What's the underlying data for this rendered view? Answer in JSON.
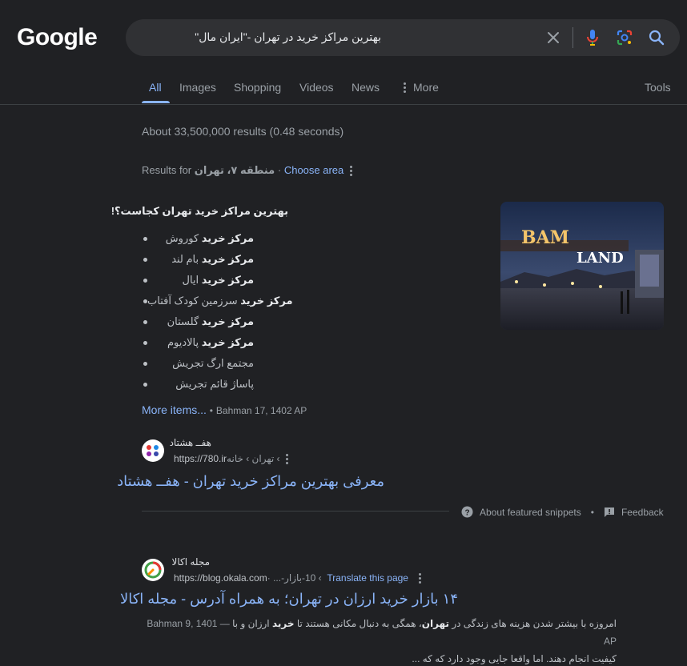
{
  "logo": "Google",
  "search": {
    "query": "بهترین مراکز خرید در تهران -\"ایران مال\""
  },
  "tabs": [
    {
      "label": "All"
    },
    {
      "label": "Images"
    },
    {
      "label": "Shopping"
    },
    {
      "label": "Videos"
    },
    {
      "label": "News"
    },
    {
      "label": "More"
    }
  ],
  "tools_label": "Tools",
  "stats": "About 33,500,000 results (0.48 seconds)",
  "results_for": {
    "prefix": "Results for",
    "area": "منطقه ۷، تهران",
    "sep": "·",
    "choose": "Choose area"
  },
  "featured": {
    "title": "بهترین مراکز خرید تهران کجاست؟!",
    "items": [
      {
        "bold": "مرکز خرید",
        "rest": " کوروش"
      },
      {
        "bold": "مرکز خرید",
        "rest": " بام لند"
      },
      {
        "bold": "مرکز خرید",
        "rest": " ایال"
      },
      {
        "bold": "مرکز خرید",
        "rest": " سرزمین کودک آفتاب"
      },
      {
        "bold": "مرکز خرید",
        "rest": " گلستان"
      },
      {
        "bold": "مرکز خرید",
        "rest": " پالادیوم"
      },
      {
        "bold": "",
        "rest": "مجتمع ارگ تجریش"
      },
      {
        "bold": "",
        "rest": "پاساژ قائم تجریش"
      }
    ],
    "more_items": "More items...",
    "date": "Bahman 17, 1402 AP",
    "image_text": {
      "a": "BAM",
      "b": "LAND"
    },
    "source": {
      "name": "هفــ هشتاد",
      "url": "https://780.ir",
      "breadcrumb": " › تهران › خانه",
      "title": "معرفی بهترین مراکز خرید تهران - هفــ هشتاد"
    },
    "about_label": "About featured snippets",
    "dot": "•",
    "feedback_label": "Feedback"
  },
  "result2": {
    "name": "مجله اکالا",
    "url": "https://blog.okala.com",
    "breadcrumb": " › 10-بازار-... ·",
    "translate": "Translate this page",
    "title": "۱۴ بازار خرید ارزان در تهران؛ به همراه آدرس - مجله اکالا",
    "date": "Bahman 9, 1401 AP",
    "dash": " — ",
    "s1": "امروزه با بیشتر شدن هزینه های زندگی در ",
    "s1b": "تهران",
    "s2": "، همگی به دنبال مکانی هستند تا ",
    "s2b": "خرید",
    "s3": " ارزان و با",
    "s4": "کیفیت انجام دهند. اما واقعا جایی وجود دارد که که ..."
  },
  "colors": {
    "background": "#202124",
    "link": "#8ab4f8",
    "searchbox": "#303134"
  }
}
